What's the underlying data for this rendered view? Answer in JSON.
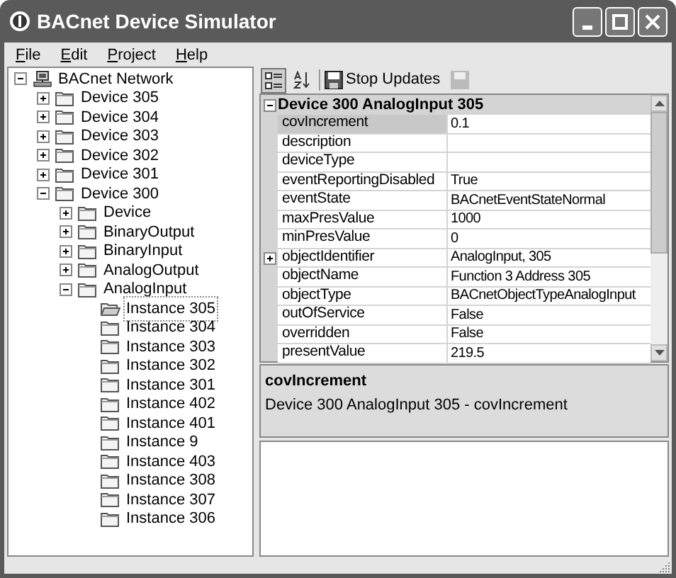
{
  "window": {
    "title": "BACnet Device Simulator"
  },
  "menu": [
    {
      "label": "File"
    },
    {
      "label": "Edit"
    },
    {
      "label": "Project"
    },
    {
      "label": "Help"
    }
  ],
  "tree": [
    {
      "label": "BACnet Network",
      "kind": "network",
      "expanded": true,
      "selected": false,
      "children": [
        {
          "label": "Device 305",
          "kind": "folder",
          "expanded": false,
          "selected": false
        },
        {
          "label": "Device 304",
          "kind": "folder",
          "expanded": false,
          "selected": false
        },
        {
          "label": "Device 303",
          "kind": "folder",
          "expanded": false,
          "selected": false
        },
        {
          "label": "Device 302",
          "kind": "folder",
          "expanded": false,
          "selected": false
        },
        {
          "label": "Device 301",
          "kind": "folder",
          "expanded": false,
          "selected": false
        },
        {
          "label": "Device 300",
          "kind": "folder",
          "expanded": true,
          "selected": false,
          "children": [
            {
              "label": "Device",
              "kind": "folder",
              "expanded": false,
              "selected": false
            },
            {
              "label": "BinaryOutput",
              "kind": "folder",
              "expanded": false,
              "selected": false
            },
            {
              "label": "BinaryInput",
              "kind": "folder",
              "expanded": false,
              "selected": false
            },
            {
              "label": "AnalogOutput",
              "kind": "folder",
              "expanded": false,
              "selected": false
            },
            {
              "label": "AnalogInput",
              "kind": "folder",
              "expanded": true,
              "selected": false,
              "children": [
                {
                  "label": "Instance 305",
                  "kind": "leaf",
                  "selected": true
                },
                {
                  "label": "Instance 304",
                  "kind": "leaf",
                  "selected": false
                },
                {
                  "label": "Instance 303",
                  "kind": "leaf",
                  "selected": false
                },
                {
                  "label": "Instance 302",
                  "kind": "leaf",
                  "selected": false
                },
                {
                  "label": "Instance 301",
                  "kind": "leaf",
                  "selected": false
                },
                {
                  "label": "Instance 402",
                  "kind": "leaf",
                  "selected": false
                },
                {
                  "label": "Instance 401",
                  "kind": "leaf",
                  "selected": false
                },
                {
                  "label": "Instance 9",
                  "kind": "leaf",
                  "selected": false
                },
                {
                  "label": "Instance 403",
                  "kind": "leaf",
                  "selected": false
                },
                {
                  "label": "Instance 308",
                  "kind": "leaf",
                  "selected": false
                },
                {
                  "label": "Instance 307",
                  "kind": "leaf",
                  "selected": false
                },
                {
                  "label": "Instance 306",
                  "kind": "leaf",
                  "selected": false
                }
              ]
            }
          ]
        }
      ]
    }
  ],
  "toolbar": {
    "categorized_selected": true,
    "alphabetical_selected": false,
    "stop_updates": "Stop Updates",
    "save_disabled": true
  },
  "property_grid": {
    "category": "Device 300 AnalogInput 305",
    "expanded": true,
    "rows": [
      {
        "name": "covIncrement",
        "value": "0.1",
        "selected": true
      },
      {
        "name": "description",
        "value": "",
        "selected": false
      },
      {
        "name": "deviceType",
        "value": "",
        "selected": false
      },
      {
        "name": "eventReportingDisabled",
        "value": "True",
        "selected": false
      },
      {
        "name": "eventState",
        "value": "BACnetEventStateNormal",
        "selected": false
      },
      {
        "name": "maxPresValue",
        "value": "1000",
        "selected": false
      },
      {
        "name": "minPresValue",
        "value": "0",
        "selected": false
      },
      {
        "name": "objectIdentifier",
        "value": "AnalogInput, 305",
        "selected": false,
        "expanded": false
      },
      {
        "name": "objectName",
        "value": "Function 3 Address 305",
        "selected": false
      },
      {
        "name": "objectType",
        "value": "BACnetObjectTypeAnalogInput",
        "selected": false
      },
      {
        "name": "outOfService",
        "value": "False",
        "selected": false
      },
      {
        "name": "overridden",
        "value": "False",
        "selected": false
      },
      {
        "name": "presentValue",
        "value": "219.5",
        "selected": false
      }
    ]
  },
  "description": {
    "title": "covIncrement",
    "text": "Device 300 AnalogInput 305 - covIncrement"
  }
}
